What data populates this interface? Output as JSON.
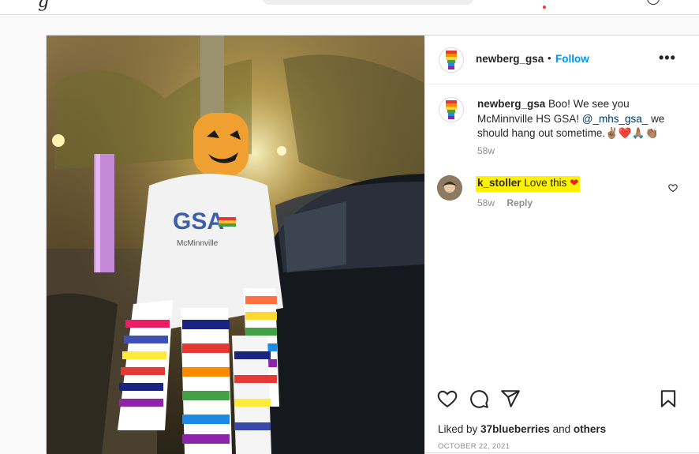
{
  "colors": {
    "accent": "#0095f6",
    "highlight": "#fff200",
    "heart": "#ed1c24"
  },
  "post": {
    "author": "newberg_gsa",
    "separator": "•",
    "follow_label": "Follow",
    "more_label": "•••",
    "caption": {
      "username": "newberg_gsa",
      "text_before": "Boo! We see you McMinnville HS GSA!",
      "mention": "@_mhs_gsa_",
      "text_after": "we should hang out sometime.",
      "emoji": "✌🏽❤️🙏🏽👏🏽",
      "age": "58w"
    },
    "comments": [
      {
        "username": "k_stoller",
        "text": "Love this",
        "heart": "❤",
        "age": "58w",
        "reply_label": "Reply"
      }
    ],
    "likes": {
      "prefix": "Liked by",
      "user": "37blueberries",
      "and": "and",
      "others": "others"
    },
    "date": "OCTOBER 22, 2021"
  },
  "icons": {
    "like": "heart-icon",
    "comment": "comment-icon",
    "share": "share-icon",
    "save": "bookmark-icon",
    "more": "more-options-icon"
  }
}
